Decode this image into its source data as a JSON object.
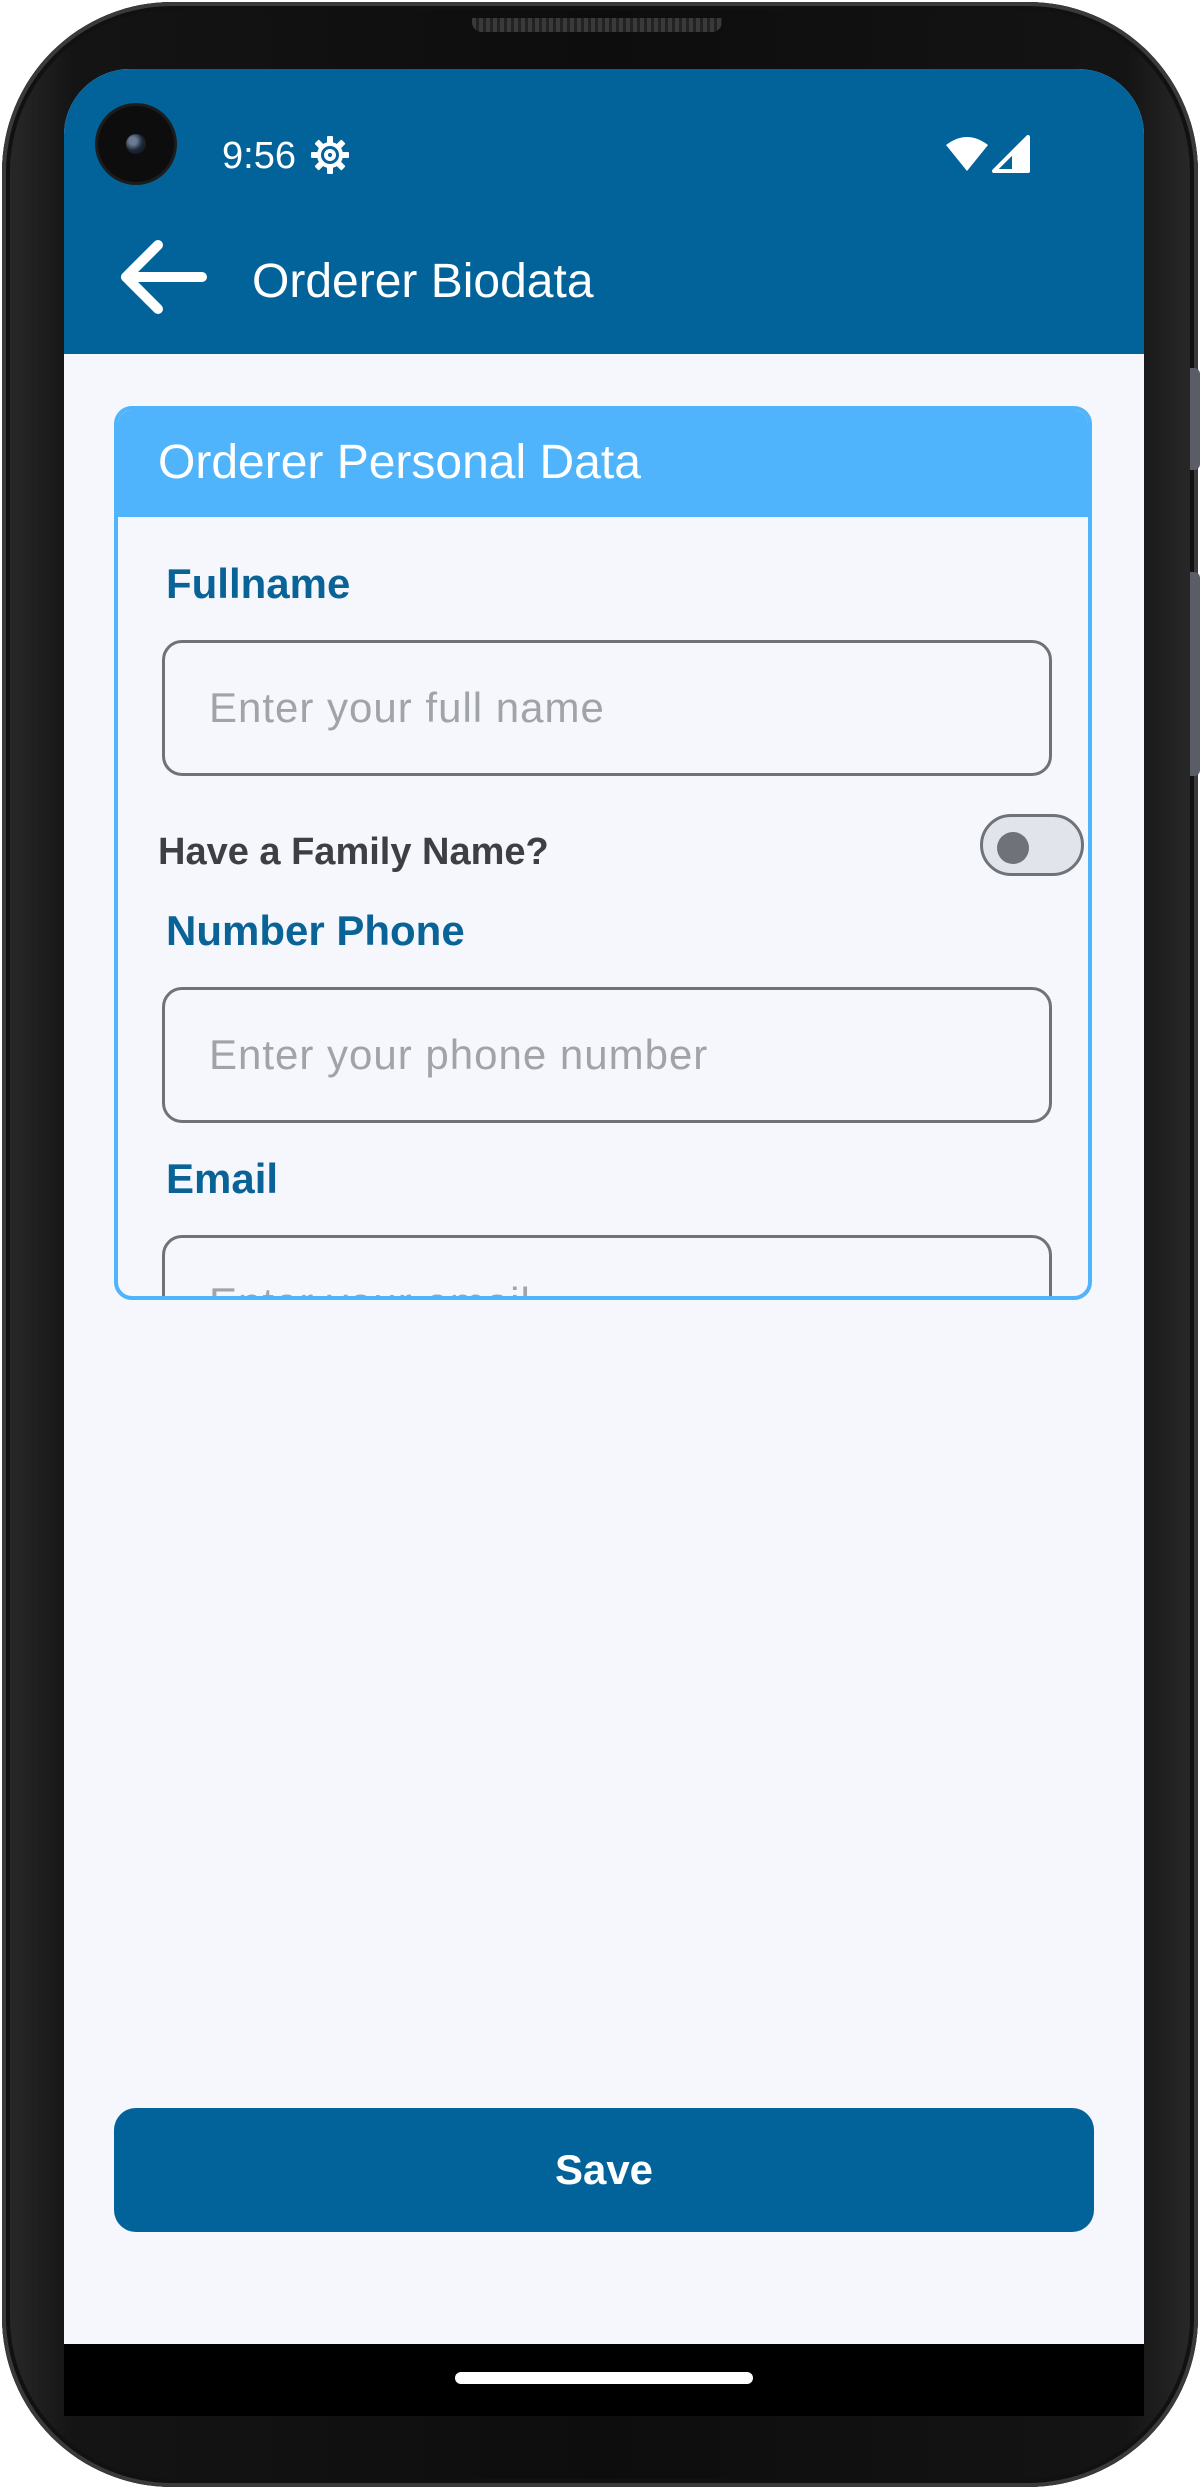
{
  "status_bar": {
    "time": "9:56",
    "icons": [
      "gear-icon",
      "wifi-icon",
      "cellular-signal-icon"
    ]
  },
  "app_bar": {
    "back_icon": "arrow-left-icon",
    "title": "Orderer Biodata"
  },
  "card": {
    "title": "Orderer Personal Data",
    "fields": [
      {
        "label": "Fullname",
        "value": "",
        "placeholder": "Enter your full name"
      },
      {
        "label": "Number Phone",
        "value": "",
        "placeholder": "Enter your phone number"
      },
      {
        "label": "Email",
        "value": "",
        "placeholder": "Enter your email"
      }
    ],
    "family_name_toggle": {
      "label": "Have a Family Name?",
      "checked": false
    }
  },
  "actions": {
    "save_label": "Save"
  },
  "colors": {
    "primary": "#02639b",
    "card_header": "#4fb4fb",
    "label": "#0a6397",
    "background": "#f5f7fc"
  }
}
